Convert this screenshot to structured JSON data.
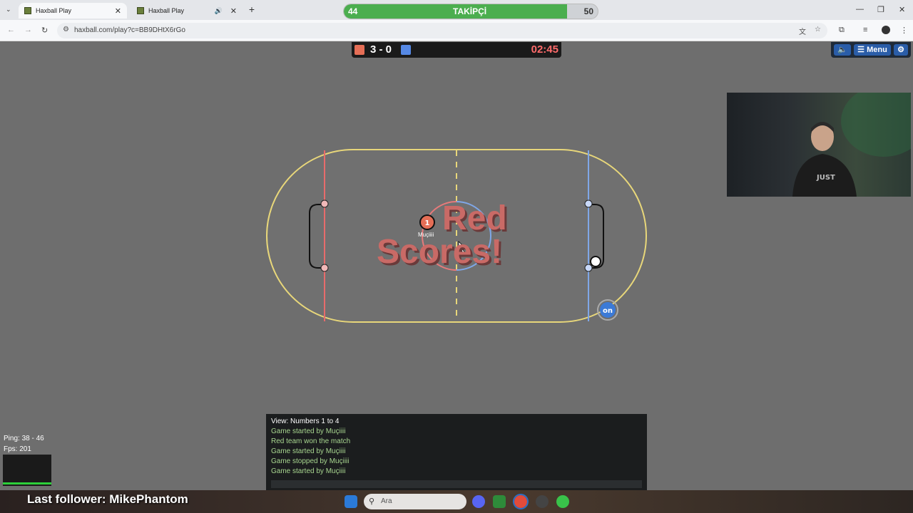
{
  "browser": {
    "tabs": [
      {
        "title": "Haxball Play",
        "active": true
      },
      {
        "title": "Haxball Play",
        "active": false
      }
    ],
    "url": "haxball.com/play?c=BB9DHtX6rGo",
    "follow_goal": {
      "current": "44",
      "label": "TAKİPÇİ",
      "target": "50",
      "progress": 0.88
    }
  },
  "game": {
    "score": "3 - 0",
    "timer": "02:45",
    "red_color": "#e56e56",
    "blue_color": "#5689e5",
    "menu_label": "Menu",
    "goal_message_line1": "Red",
    "goal_message_line2": "Scores!",
    "player_number": "1",
    "player_name": "Muçiiii",
    "on_badge": "on"
  },
  "stats": {
    "ping": "Ping: 38 - 46",
    "fps": "Fps: 201"
  },
  "chat": {
    "header": "View: Numbers 1 to 4",
    "messages": [
      "Game started by Muçiiii",
      "Red team won the match",
      "Game started by Muçiiii",
      "Game stopped by Muçiiii",
      "Game started by Muçiiii"
    ]
  },
  "overlay": {
    "last_follower": "Last follower: MikePhantom"
  },
  "taskbar": {
    "search_placeholder": "Ara"
  }
}
